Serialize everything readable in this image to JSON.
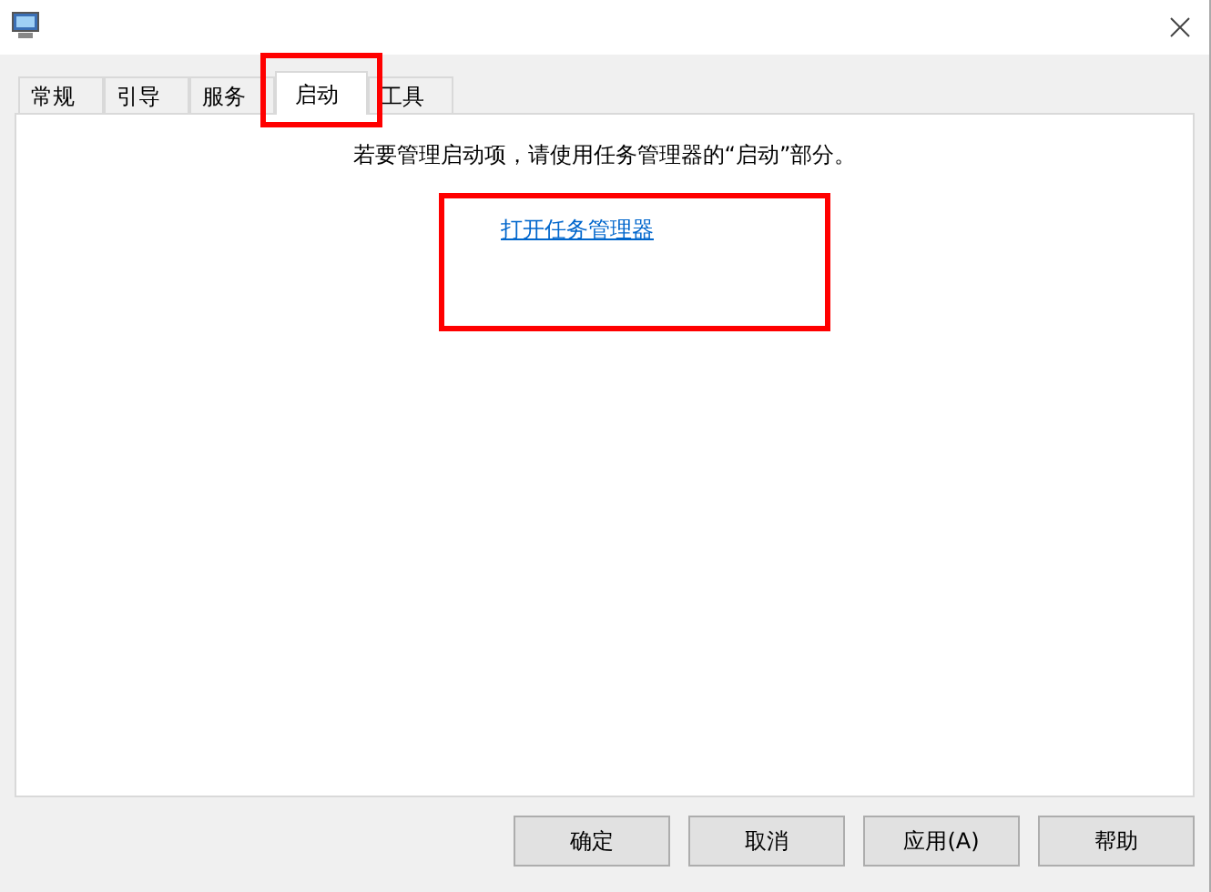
{
  "tabs": [
    {
      "label": "常规",
      "selected": false
    },
    {
      "label": "引导",
      "selected": false
    },
    {
      "label": "服务",
      "selected": false
    },
    {
      "label": "启动",
      "selected": true
    },
    {
      "label": "工具",
      "selected": false
    }
  ],
  "panel": {
    "message": "若要管理启动项，请使用任务管理器的“启动”部分。",
    "link": "打开任务管理器"
  },
  "buttons": [
    "确定",
    "取消",
    "应用(A)",
    "帮助"
  ]
}
